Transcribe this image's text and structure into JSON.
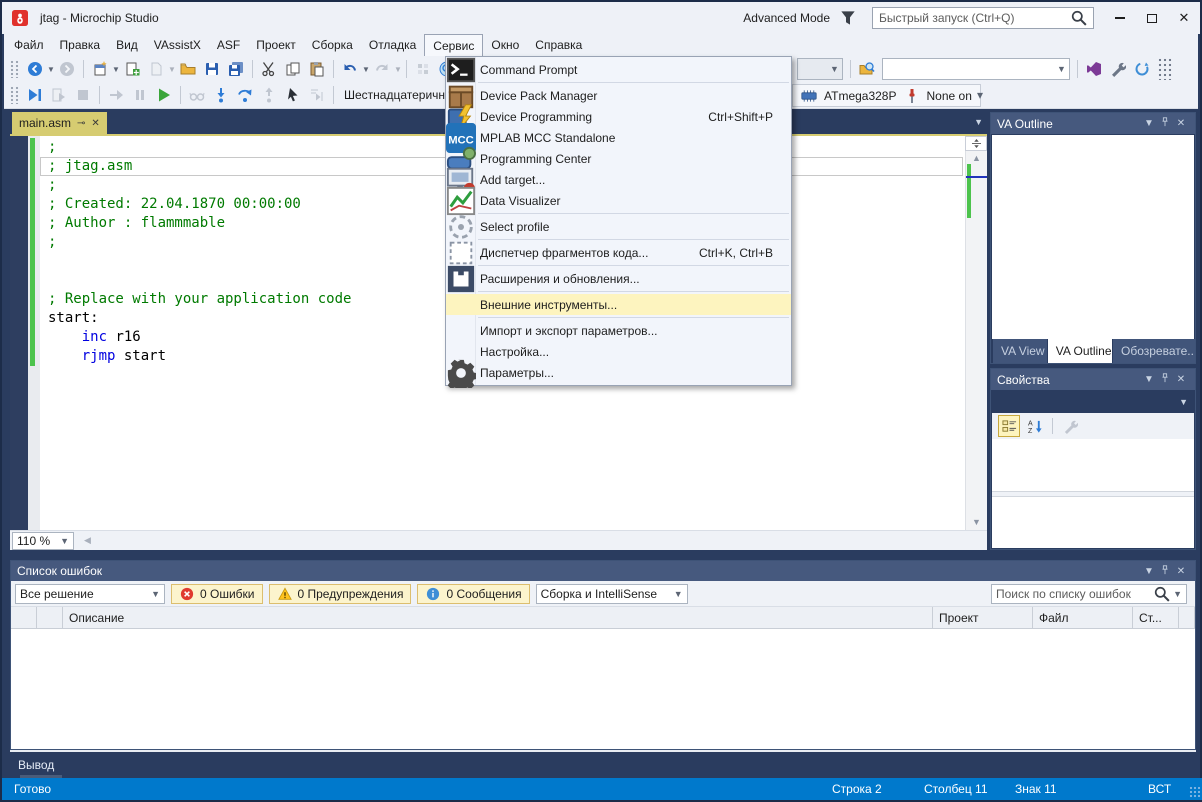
{
  "window": {
    "title": "jtag - Microchip Studio",
    "mode_label": "Advanced Mode",
    "quick_launch_placeholder": "Быстрый запуск (Ctrl+Q)",
    "icons": [
      "app-logo",
      "funnel",
      "search",
      "minimize",
      "maximize",
      "close"
    ]
  },
  "menubar": {
    "items": [
      "Файл",
      "Правка",
      "Вид",
      "VAssistX",
      "ASF",
      "Проект",
      "Сборка",
      "Отладка",
      "Сервис",
      "Окно",
      "Справка"
    ],
    "open_item": "Сервис"
  },
  "tools_menu": {
    "items": [
      {
        "id": "command-prompt",
        "label": "Command Prompt",
        "icon": "command-prompt",
        "sep_after": true
      },
      {
        "id": "device-pack-manager",
        "label": "Device Pack Manager",
        "icon": "package"
      },
      {
        "id": "device-programming",
        "label": "Device Programming",
        "shortcut": "Ctrl+Shift+P",
        "icon": "chip-lightning"
      },
      {
        "id": "mplab-mcc-standalone",
        "label": "MPLAB MCC Standalone",
        "icon": "mcc"
      },
      {
        "id": "programming-center",
        "label": "Programming Center",
        "icon": "chip-green"
      },
      {
        "id": "add-target",
        "label": "Add target...",
        "icon": "add-target"
      },
      {
        "id": "data-visualizer",
        "label": "Data Visualizer",
        "icon": "chart",
        "sep_after": true
      },
      {
        "id": "select-profile",
        "label": "Select profile",
        "icon": "profile",
        "sep_after": true
      },
      {
        "id": "code-snippets-manager",
        "label": "Диспетчер фрагментов кода...",
        "shortcut": "Ctrl+K, Ctrl+B",
        "icon": "snippet",
        "sep_after": true
      },
      {
        "id": "extensions-updates",
        "label": "Расширения и обновления...",
        "icon": "extensions",
        "sep_after": true
      },
      {
        "id": "external-tools",
        "label": "Внешние инструменты...",
        "highlight": true,
        "sep_after": true
      },
      {
        "id": "import-export-settings",
        "label": "Импорт и экспорт параметров..."
      },
      {
        "id": "customize",
        "label": "Настройка..."
      },
      {
        "id": "options",
        "label": "Параметры...",
        "icon": "gear"
      }
    ],
    "highlight_color": "#FDF4BF"
  },
  "toolbars": {
    "row1_left": [
      {
        "type": "grip"
      },
      {
        "type": "button",
        "icon": "nav-back",
        "dropdown": true
      },
      {
        "type": "button",
        "icon": "nav-forward",
        "disabled": true
      },
      {
        "type": "sep"
      },
      {
        "type": "button",
        "icon": "new-project",
        "dropdown": true
      },
      {
        "type": "button",
        "icon": "add-item"
      },
      {
        "type": "button",
        "icon": "new-file",
        "disabled": true,
        "dropdown": true
      },
      {
        "type": "button",
        "icon": "open-folder"
      },
      {
        "type": "button",
        "icon": "save"
      },
      {
        "type": "button",
        "icon": "save-all"
      },
      {
        "type": "sep"
      },
      {
        "type": "button",
        "icon": "cut"
      },
      {
        "type": "button",
        "icon": "copy"
      },
      {
        "type": "button",
        "icon": "paste"
      },
      {
        "type": "sep"
      },
      {
        "type": "button",
        "icon": "undo",
        "dropdown": true
      },
      {
        "type": "button",
        "icon": "redo",
        "disabled": true,
        "dropdown": true
      },
      {
        "type": "sep"
      },
      {
        "type": "button",
        "icon": "block-select",
        "disabled": true
      },
      {
        "type": "button",
        "icon": "navigate-to"
      }
    ],
    "row1_right": [
      {
        "type": "combo",
        "width": 46,
        "disabled": true
      },
      {
        "type": "sep"
      },
      {
        "type": "button",
        "icon": "find-in-files"
      },
      {
        "type": "combo",
        "width": 188
      },
      {
        "type": "sep"
      },
      {
        "type": "button",
        "icon": "vs-logo"
      },
      {
        "type": "button",
        "icon": "wrench"
      },
      {
        "type": "button",
        "icon": "feedback"
      },
      {
        "type": "overflow"
      }
    ],
    "row2": [
      {
        "type": "grip"
      },
      {
        "type": "button",
        "icon": "debug-continue"
      },
      {
        "type": "button",
        "icon": "debug-restart",
        "disabled": true
      },
      {
        "type": "button",
        "icon": "debug-stop",
        "disabled": true
      },
      {
        "type": "sep"
      },
      {
        "type": "button",
        "icon": "attach",
        "disabled": true
      },
      {
        "type": "button",
        "icon": "debug-pause",
        "disabled": true
      },
      {
        "type": "button",
        "icon": "run-green"
      },
      {
        "type": "sep"
      },
      {
        "type": "button",
        "icon": "breakpoints-glasses",
        "disabled": true
      },
      {
        "type": "button",
        "icon": "step-into"
      },
      {
        "type": "button",
        "icon": "step-over"
      },
      {
        "type": "button",
        "icon": "step-out",
        "disabled": true
      },
      {
        "type": "button",
        "icon": "cursor-arrow"
      },
      {
        "type": "button",
        "icon": "run-to-cursor",
        "disabled": true
      },
      {
        "type": "sep"
      }
    ],
    "hex_label": "Шестнадцатеричный вы",
    "device_label": "ATmega328P",
    "device_icon": "chip",
    "interface_label": "None on",
    "interface_icon": "tool-red"
  },
  "editor": {
    "tab_label": "main.asm",
    "tab_icons": [
      "pin",
      "close"
    ],
    "zoom_level": "110 %",
    "code_lines": [
      {
        "tokens": [
          [
            ";",
            "c"
          ]
        ]
      },
      {
        "tokens": [
          [
            "; jtag.asm",
            "c"
          ]
        ],
        "current": true
      },
      {
        "tokens": [
          [
            ";",
            "c"
          ]
        ]
      },
      {
        "tokens": [
          [
            "; Created: 22.04.1870 00:00:00",
            "c"
          ]
        ]
      },
      {
        "tokens": [
          [
            "; Author : flammmable",
            "c"
          ]
        ]
      },
      {
        "tokens": [
          [
            ";",
            "c"
          ]
        ]
      },
      {
        "tokens": []
      },
      {
        "tokens": []
      },
      {
        "tokens": [
          [
            "; Replace with your application code",
            "c"
          ]
        ]
      },
      {
        "tokens": [
          [
            "start:",
            "p"
          ]
        ]
      },
      {
        "tokens": [
          [
            "    ",
            "p"
          ],
          [
            "inc",
            "k"
          ],
          [
            " r16",
            "p"
          ]
        ]
      },
      {
        "tokens": [
          [
            "    ",
            "p"
          ],
          [
            "rjmp",
            "k"
          ],
          [
            " start",
            "p"
          ]
        ]
      }
    ],
    "colors": {
      "comment": "#007A00",
      "keyword": "#0000E0",
      "change_bar": "#4DC34D",
      "tab": "#D6CC71"
    }
  },
  "va_panel": {
    "title": "VA Outline",
    "tabs": [
      "VA View",
      "VA Outline",
      "Обозревате..."
    ],
    "active_tab": "VA Outline"
  },
  "properties_panel": {
    "title": "Свойства",
    "toolbar_icons": [
      "categorized",
      "sort-az",
      "wrench"
    ]
  },
  "error_list": {
    "title": "Список ошибок",
    "scope_filter": "Все решение",
    "errors_label": "0 Ошибки",
    "warnings_label": "0 Предупреждения",
    "messages_label": "0 Сообщения",
    "source_filter": "Сборка и IntelliSense",
    "search_placeholder": "Поиск по списку ошибок",
    "columns": [
      "",
      "",
      "Описание",
      "Проект",
      "Файл",
      "Ст...",
      ""
    ],
    "status_colors": {
      "error": "#E03A2F",
      "warning": "#FFC31F",
      "info": "#3E8ED6"
    }
  },
  "output_panel": {
    "label": "Вывод"
  },
  "status_bar": {
    "ready": "Готово",
    "line": "Строка 2",
    "column": "Столбец 11",
    "char": "Знак 11",
    "mode": "ВСТ",
    "background": "#0079CC"
  }
}
